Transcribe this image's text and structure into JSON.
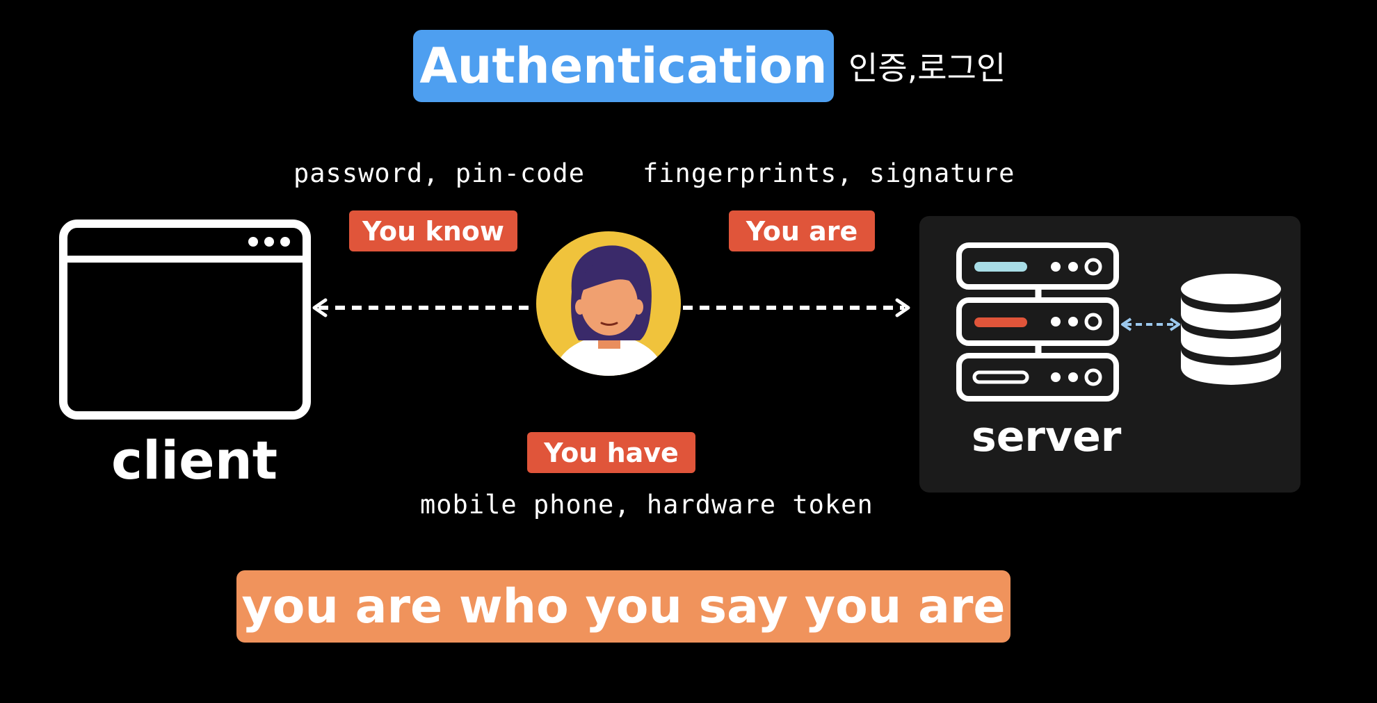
{
  "title": {
    "main": "Authentication",
    "korean": "인증,로그인"
  },
  "factors": {
    "know": {
      "tag": "You know",
      "examples": "password, pin-code"
    },
    "are": {
      "tag": "You are",
      "examples": "fingerprints, signature"
    },
    "have": {
      "tag": "You have",
      "examples": "mobile phone, hardware token"
    }
  },
  "nodes": {
    "client": "client",
    "server": "server"
  },
  "banner": "you are who you say you are",
  "colors": {
    "background": "#000000",
    "title_pill": "#4e9ff0",
    "tag": "#e0553a",
    "banner": "#f0935c",
    "server_panel": "#1b1b1b",
    "avatar_circle": "#f0c33c",
    "avatar_skin": "#f0a070",
    "avatar_hair": "#3a2a6a",
    "db_link": "#9cc9ee",
    "server_slot_1": "#a8dde6",
    "server_slot_2": "#e0553a"
  },
  "icons": {
    "client": "browser-window-icon",
    "user": "person-avatar-icon",
    "server": "server-rack-icon",
    "database": "database-icon"
  }
}
